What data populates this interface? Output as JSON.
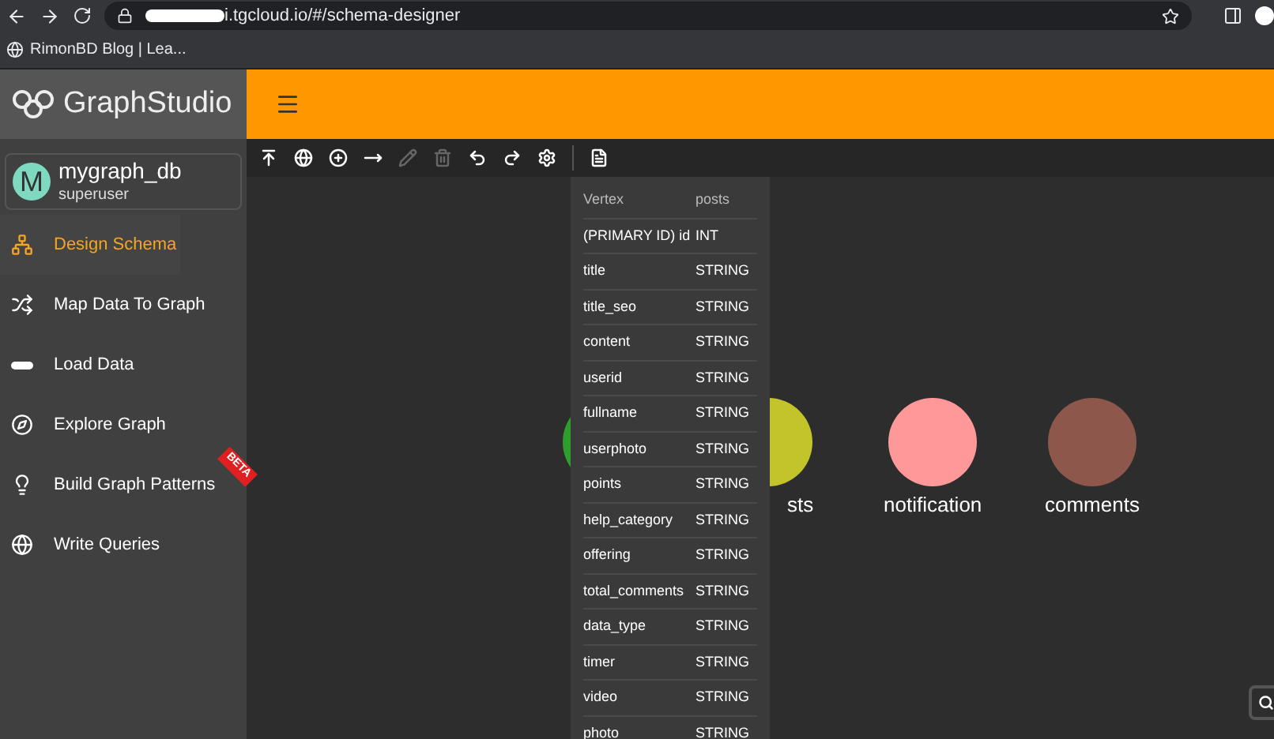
{
  "browser": {
    "url": "i.tgcloud.io/#/schema-designer",
    "bookmark": "RimonBD Blog | Lea..."
  },
  "logo": "GraphStudio",
  "graph": {
    "avatar": "M",
    "name": "mygraph_db",
    "role": "superuser"
  },
  "sidebar": {
    "items": [
      {
        "label": "Design Schema",
        "selected": true
      },
      {
        "label": "Map Data To Graph",
        "selected": false
      },
      {
        "label": "Load Data",
        "selected": false
      },
      {
        "label": "Explore Graph",
        "selected": false
      },
      {
        "label": "Build Graph Patterns",
        "selected": false,
        "badge": "BETA"
      },
      {
        "label": "Write Queries",
        "selected": false
      }
    ]
  },
  "toolbar": [
    {
      "disabled": false
    },
    {
      "disabled": false
    },
    {
      "disabled": false
    },
    {
      "disabled": false
    },
    {
      "disabled": true
    },
    {
      "disabled": true
    },
    {
      "disabled": false
    },
    {
      "disabled": false
    },
    {
      "disabled": false
    },
    {
      "disabled": false
    }
  ],
  "vertices": [
    {
      "color": "#2e9e2e"
    },
    {
      "label": "sts",
      "color": "#c3c32a"
    },
    {
      "label": "notification",
      "color": "#ff9999"
    },
    {
      "label": "comments",
      "color": "#8d574b"
    }
  ],
  "details": {
    "header": [
      "Vertex",
      "posts"
    ],
    "rows": [
      [
        "(PRIMARY ID) id",
        "INT"
      ],
      [
        "title",
        "STRING"
      ],
      [
        "title_seo",
        "STRING"
      ],
      [
        "content",
        "STRING"
      ],
      [
        "userid",
        "STRING"
      ],
      [
        "fullname",
        "STRING"
      ],
      [
        "userphoto",
        "STRING"
      ],
      [
        "points",
        "STRING"
      ],
      [
        "help_category",
        "STRING"
      ],
      [
        "offering",
        "STRING"
      ],
      [
        "total_comments",
        "STRING"
      ],
      [
        "data_type",
        "STRING"
      ],
      [
        "timer",
        "STRING"
      ],
      [
        "video",
        "STRING"
      ],
      [
        "photo",
        "STRING"
      ]
    ]
  }
}
